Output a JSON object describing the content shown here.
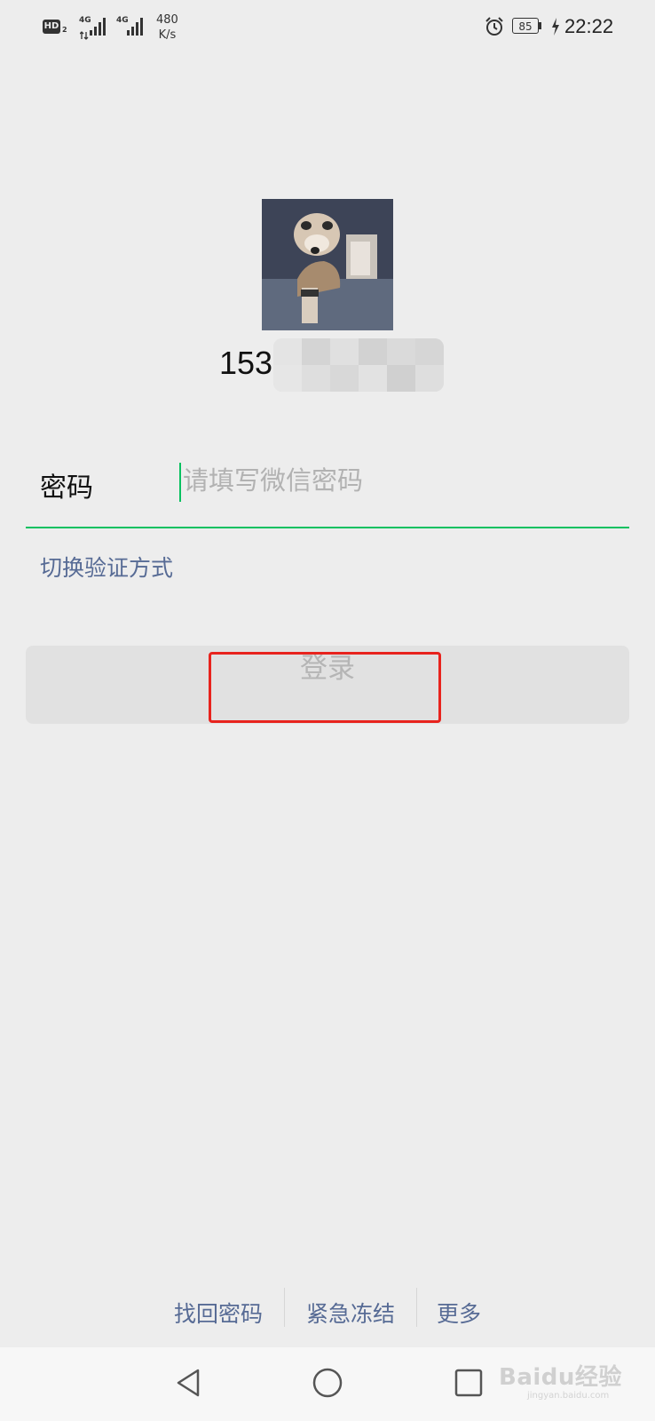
{
  "status_bar": {
    "hd_label": "HD",
    "hd_sub": "2",
    "network_1": "4G",
    "network_2": "4G",
    "speed_value": "480",
    "speed_unit": "K/s",
    "battery": "85",
    "time": "22:22"
  },
  "account": {
    "phone_prefix": "153"
  },
  "password": {
    "label": "密码",
    "placeholder": "请填写微信密码",
    "value": ""
  },
  "switch_verification": "切换验证方式",
  "login_button": "登录",
  "bottom_links": {
    "recover_password": "找回密码",
    "emergency_freeze": "紧急冻结",
    "more": "更多"
  },
  "watermark": {
    "brand": "Baidu经验",
    "url": "jingyan.baidu.com"
  },
  "colors": {
    "accent_green": "#07c160",
    "link_blue": "#576b95",
    "highlight_red": "#e8231d",
    "background": "#ededed"
  },
  "icons": [
    "alarm-icon",
    "battery-icon",
    "charging-icon",
    "signal-icon",
    "back-icon",
    "home-icon",
    "recents-icon"
  ]
}
